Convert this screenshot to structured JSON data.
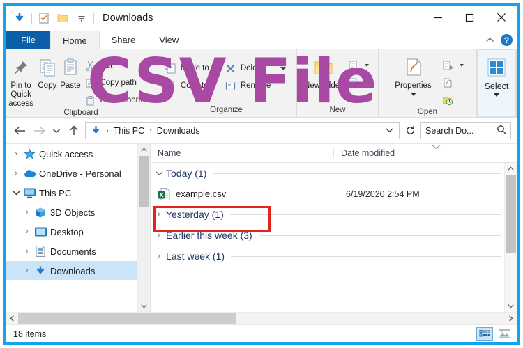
{
  "window": {
    "title": "Downloads",
    "frame_color": "#12A3E8",
    "quick_access_icons": [
      "download-arrow-icon",
      "properties-checklist-icon",
      "new-folder-icon",
      "customize-chevron-icon"
    ],
    "controls": {
      "minimize": "minimize-icon",
      "maximize": "maximize-icon",
      "close": "close-icon"
    }
  },
  "watermark": {
    "text": "CSV File",
    "color": "#A849A3"
  },
  "ribbon": {
    "tabs": [
      {
        "label": "File",
        "state": "file-menu"
      },
      {
        "label": "Home",
        "state": "active"
      },
      {
        "label": "Share",
        "state": "normal"
      },
      {
        "label": "View",
        "state": "normal"
      }
    ],
    "collapse_label": "⌃",
    "help_label": "?",
    "groups": [
      {
        "name": "Clipboard",
        "label": "Clipboard",
        "big_buttons": [
          {
            "label": "Pin to Quick access",
            "icon": "pin-icon"
          },
          {
            "label": "Copy",
            "icon": "copy-icon"
          },
          {
            "label": "Paste",
            "icon": "paste-icon"
          }
        ],
        "small_buttons": [
          {
            "label": "Cut",
            "icon": "cut-icon"
          },
          {
            "label": "Copy path",
            "icon": "copy-path-icon"
          },
          {
            "label": "Paste shortcut",
            "icon": "paste-shortcut-icon"
          }
        ]
      },
      {
        "name": "Organize",
        "label": "Organize",
        "small_buttons": [
          {
            "label": "Move to",
            "icon": "move-to-icon",
            "has_caret": true
          },
          {
            "label": "Copy to",
            "icon": "copy-to-icon",
            "has_caret": true
          },
          {
            "label": "Delete",
            "icon": "delete-x-icon",
            "has_caret": true
          },
          {
            "label": "Rename",
            "icon": "rename-icon",
            "has_caret": false
          }
        ]
      },
      {
        "name": "New",
        "label": "New",
        "big_buttons": [
          {
            "label": "New folder",
            "icon": "new-folder-icon"
          }
        ],
        "small_buttons": [
          {
            "label": "New item",
            "icon": "new-item-icon",
            "has_caret": true
          },
          {
            "label": "Easy access",
            "icon": "easy-access-icon",
            "has_caret": true
          }
        ]
      },
      {
        "name": "Open",
        "label": "Open",
        "big_buttons": [
          {
            "label": "Properties",
            "icon": "properties-icon"
          }
        ],
        "small_buttons": [
          {
            "label": "Open",
            "icon": "open-icon",
            "has_caret": true
          },
          {
            "label": "Edit",
            "icon": "edit-icon",
            "has_caret": false
          },
          {
            "label": "History",
            "icon": "history-icon",
            "has_caret": false
          }
        ]
      },
      {
        "name": "Select",
        "label": "",
        "big_buttons": [
          {
            "label": "Select",
            "icon": "select-grid-icon"
          }
        ]
      }
    ]
  },
  "addressbar": {
    "back_icon": "back-arrow-icon",
    "forward_icon": "forward-arrow-icon",
    "recent_icon": "recent-locations-chevron-icon",
    "up_icon": "up-arrow-icon",
    "path_icon": "downloads-arrow-icon",
    "crumbs": [
      "This PC",
      "Downloads"
    ],
    "dropdown_icon": "chevron-down-icon",
    "refresh_icon": "refresh-icon",
    "search": {
      "placeholder": "Search Do...",
      "value": "Search Do...",
      "icon": "search-icon"
    }
  },
  "navpane": {
    "items": [
      {
        "label": "Quick access",
        "icon": "star-icon",
        "expanded": false,
        "indent": 0,
        "selected": false
      },
      {
        "label": "OneDrive - Personal",
        "icon": "onedrive-cloud-icon",
        "expanded": false,
        "indent": 0,
        "selected": false
      },
      {
        "label": "This PC",
        "icon": "this-pc-monitor-icon",
        "expanded": true,
        "indent": 0,
        "selected": false
      },
      {
        "label": "3D Objects",
        "icon": "3d-objects-icon",
        "expanded": false,
        "indent": 1,
        "selected": false
      },
      {
        "label": "Desktop",
        "icon": "desktop-icon",
        "expanded": false,
        "indent": 1,
        "selected": false
      },
      {
        "label": "Documents",
        "icon": "documents-icon",
        "expanded": false,
        "indent": 1,
        "selected": false
      },
      {
        "label": "Downloads",
        "icon": "downloads-arrow-icon",
        "expanded": false,
        "indent": 1,
        "selected": true
      }
    ]
  },
  "filelist": {
    "columns": [
      {
        "label": "Name",
        "key": "name"
      },
      {
        "label": "Date modified",
        "key": "date"
      }
    ],
    "groups": [
      {
        "label": "Today (1)",
        "expanded": true,
        "files": [
          {
            "name": "example.csv",
            "date": "6/19/2020 2:54 PM",
            "icon": "csv-excel-icon",
            "highlighted": true
          }
        ]
      },
      {
        "label": "Yesterday (1)",
        "expanded": false,
        "files": []
      },
      {
        "label": "Earlier this week (3)",
        "expanded": false,
        "files": []
      },
      {
        "label": "Last week (1)",
        "expanded": false,
        "files": []
      }
    ],
    "highlight_color": "#E1241C"
  },
  "statusbar": {
    "item_count": "18 items",
    "view_buttons": [
      {
        "name": "details-view",
        "icon": "details-view-icon",
        "active": true
      },
      {
        "name": "large-icons-view",
        "icon": "large-icons-view-icon",
        "active": false
      }
    ]
  }
}
